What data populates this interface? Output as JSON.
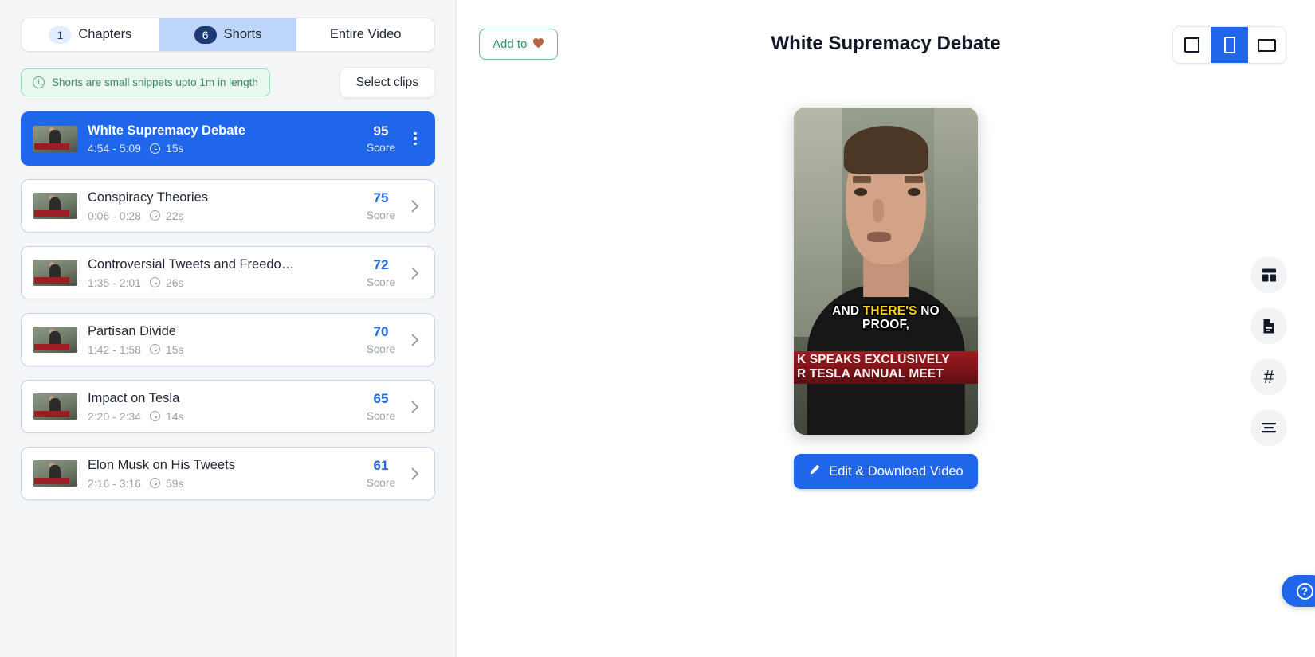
{
  "tabs": [
    {
      "badge": "1",
      "label": "Chapters",
      "active": false
    },
    {
      "badge": "6",
      "label": "Shorts",
      "active": true
    },
    {
      "badge": "",
      "label": "Entire Video",
      "active": false
    }
  ],
  "info_banner": {
    "text": "Shorts are small snippets upto 1m in length",
    "icon": "info-icon"
  },
  "select_clips_label": "Select clips",
  "score_label": "Score",
  "clips": [
    {
      "title": "White Supremacy Debate",
      "range": "4:54 - 5:09",
      "duration": "15s",
      "score": "95",
      "score_label": "Score",
      "selected": true
    },
    {
      "title": "Conspiracy Theories",
      "range": "0:06 - 0:28",
      "duration": "22s",
      "score": "75",
      "score_label": "Score",
      "selected": false
    },
    {
      "title": "Controversial Tweets and Freedom...",
      "range": "1:35 - 2:01",
      "duration": "26s",
      "score": "72",
      "score_label": "Score",
      "selected": false
    },
    {
      "title": "Partisan Divide",
      "range": "1:42 - 1:58",
      "duration": "15s",
      "score": "70",
      "score_label": "Score",
      "selected": false
    },
    {
      "title": "Impact on Tesla",
      "range": "2:20 - 2:34",
      "duration": "14s",
      "score": "65",
      "score_label": "Score",
      "selected": false
    },
    {
      "title": "Elon Musk on His Tweets",
      "range": "2:16 - 3:16",
      "duration": "59s",
      "score": "61",
      "score_label": "Score",
      "selected": false
    }
  ],
  "header": {
    "add_favorite_label": "Add to",
    "add_favorite_icon": "heart-icon",
    "title": "White Supremacy Debate"
  },
  "ratio_buttons": [
    {
      "name": "square",
      "active": false
    },
    {
      "name": "portrait",
      "active": true
    },
    {
      "name": "landscape",
      "active": false
    }
  ],
  "preview": {
    "caption_before": "AND ",
    "caption_highlight": "THERE'S",
    "caption_after": " NO",
    "caption_line2": "PROOF,",
    "news_line1": "K SPEAKS EXCLUSIVELY",
    "news_line2": "R TESLA ANNUAL MEET"
  },
  "edit_button": {
    "label": "Edit & Download Video",
    "icon": "pencil-icon"
  },
  "rail": [
    {
      "icon": "layout-template-icon"
    },
    {
      "icon": "document-icon"
    },
    {
      "icon": "hashtag-icon",
      "glyph": "#"
    },
    {
      "icon": "text-align-icon"
    }
  ],
  "help": {
    "icon": "help-circle-icon",
    "glyph": "?"
  },
  "colors": {
    "accent_blue": "#1f66eb",
    "tab_active_bg": "#bed5fb",
    "badge_active_bg": "#1e3a75",
    "info_green_text": "#3f8a63",
    "info_green_bg": "#e9f8ef",
    "favorite_green": "#2f8f63",
    "caption_highlight": "#ffd400",
    "news_red": "#9d1c22"
  }
}
